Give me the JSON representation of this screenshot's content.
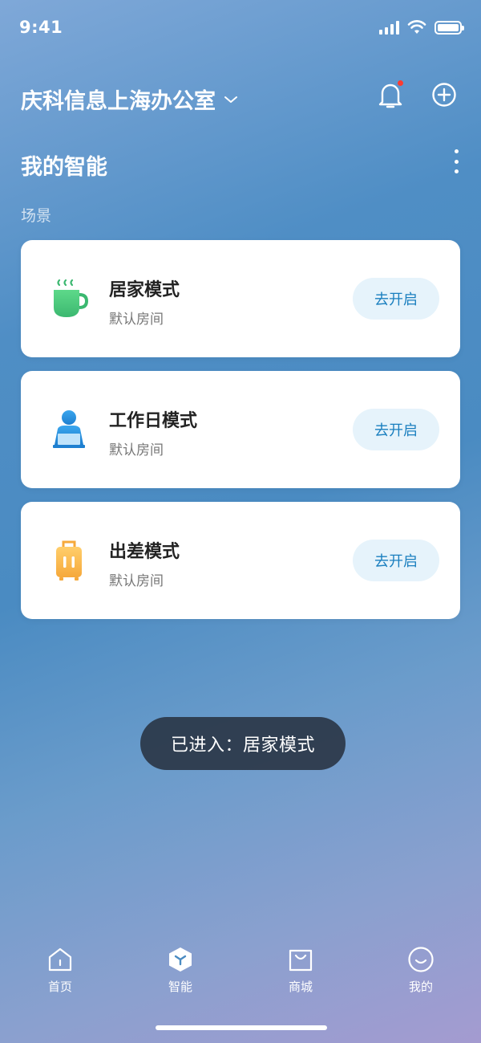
{
  "status_bar": {
    "time": "9:41"
  },
  "header": {
    "title": "庆科信息上海办公室"
  },
  "section": {
    "title": "我的智能",
    "subtitle": "场景"
  },
  "scenes": [
    {
      "name": "居家模式",
      "room": "默认房间",
      "button": "去开启",
      "icon": "tea-cup-icon"
    },
    {
      "name": "工作日模式",
      "room": "默认房间",
      "button": "去开启",
      "icon": "office-worker-icon"
    },
    {
      "name": "出差模式",
      "room": "默认房间",
      "button": "去开启",
      "icon": "luggage-icon"
    }
  ],
  "toast": {
    "text": "已进入：居家模式"
  },
  "tabs": [
    {
      "label": "首页",
      "icon": "home-icon"
    },
    {
      "label": "智能",
      "icon": "smart-icon",
      "active": true
    },
    {
      "label": "商城",
      "icon": "shopping-bag-icon"
    },
    {
      "label": "我的",
      "icon": "profile-icon"
    }
  ],
  "colors": {
    "accent": "#1a7fbf",
    "button_bg": "#e6f3fb",
    "notification_dot": "#ff3b30"
  }
}
